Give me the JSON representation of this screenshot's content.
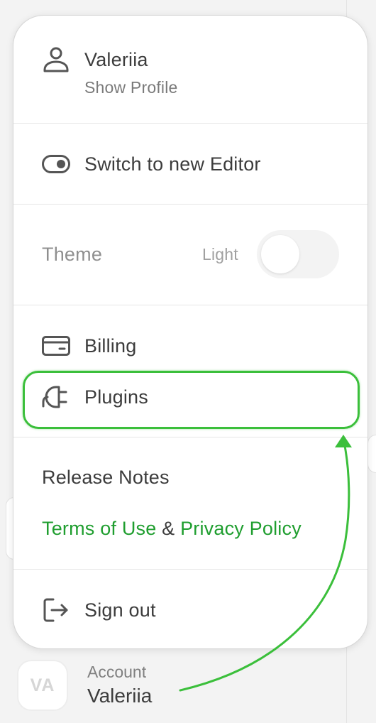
{
  "menu": {
    "profile": {
      "name": "Valeriia",
      "sub": "Show Profile",
      "icon": "user-icon"
    },
    "editor": {
      "label": "Switch to new Editor",
      "icon": "toggle-icon"
    },
    "theme": {
      "label": "Theme",
      "value": "Light",
      "enabled": false
    },
    "billing": {
      "label": "Billing",
      "icon": "card-icon"
    },
    "plugins": {
      "label": "Plugins",
      "icon": "plug-icon"
    },
    "release_notes": "Release Notes",
    "legal": {
      "terms": "Terms of Use",
      "and": "&",
      "privacy": "Privacy Policy"
    },
    "signout": {
      "label": "Sign out",
      "icon": "sign-out-icon"
    }
  },
  "account": {
    "initials": "VA",
    "caption": "Account",
    "name": "Valeriia"
  },
  "colors": {
    "link": "#1f9e2f",
    "highlight": "#3bbf3b"
  }
}
